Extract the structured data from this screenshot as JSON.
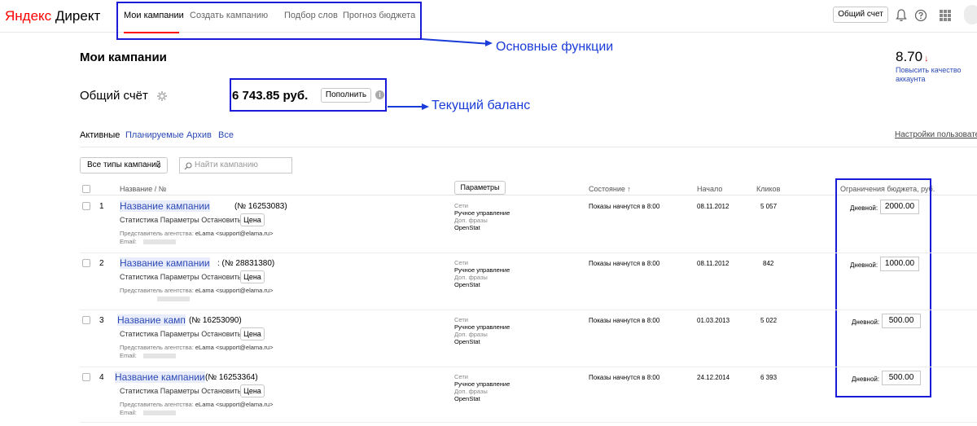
{
  "header": {
    "logo_ya": "Яндекс",
    "logo_product": "Директ",
    "nav": [
      "Мои кампании",
      "Создать кампанию",
      "Подбор слов",
      "Прогноз бюджета"
    ],
    "shared_account_button": "Общий счет"
  },
  "annotations": {
    "main_functions": "Основные функции",
    "current_balance": "Текущий баланс"
  },
  "page": {
    "title": "Мои кампании",
    "quality_score": "8.70",
    "quality_link": "Повысить качество аккаунта",
    "account_title": "Общий счёт",
    "balance": "6 743.85 руб.",
    "topup_button": "Пополнить"
  },
  "tabs": {
    "items": [
      "Активные",
      "Планируемые",
      "Архив",
      "Все"
    ],
    "settings_link": "Настройки пользовател"
  },
  "filters": {
    "type_select": "Все типы кампаний",
    "search_placeholder": "Найти кампанию"
  },
  "table": {
    "headers": {
      "name": "Название / №",
      "params_button": "Параметры",
      "state": "Состояние ↑",
      "start": "Начало",
      "clicks": "Кликов",
      "budget": "Ограничения бюджета, руб."
    },
    "actions": [
      "Статистика",
      "Параметры",
      "Остановить"
    ],
    "price_button": "Цена",
    "agency_label": "Представитель агентства:",
    "agency_value": "eLama <support@elama.ru>",
    "email_label": "Email:",
    "strategy_labels": [
      "Сети",
      "Ручное управление",
      "Доп. фразы",
      "OpenStat"
    ],
    "daily_label": "Дневной:",
    "rows": [
      {
        "num": "1",
        "name": "Название кампании",
        "id": "(№ 16253083)",
        "state": "Показы начнутся в 8:00",
        "start": "08.11.2012",
        "clicks": "5 057",
        "budget": "2000.00"
      },
      {
        "num": "2",
        "name": "Название кампании",
        "id": ": (№ 28831380)",
        "state": "Показы начнутся в 8:00",
        "start": "08.11.2012",
        "clicks": "842",
        "budget": "1000.00"
      },
      {
        "num": "3",
        "name": "Название камп",
        "id": "(№ 16253090)",
        "state": "Показы начнутся в 8:00",
        "start": "01.03.2013",
        "clicks": "5 022",
        "budget": "500.00"
      },
      {
        "num": "4",
        "name": "Название кампании",
        "id": "(№ 16253364)",
        "state": "Показы начнутся в 8:00",
        "start": "24.12.2014",
        "clicks": "6 393",
        "budget": "500.00"
      }
    ]
  },
  "colors": {
    "link": "#2b49b5",
    "annotation": "#1a1ad9",
    "brand_red": "#ff0000"
  }
}
